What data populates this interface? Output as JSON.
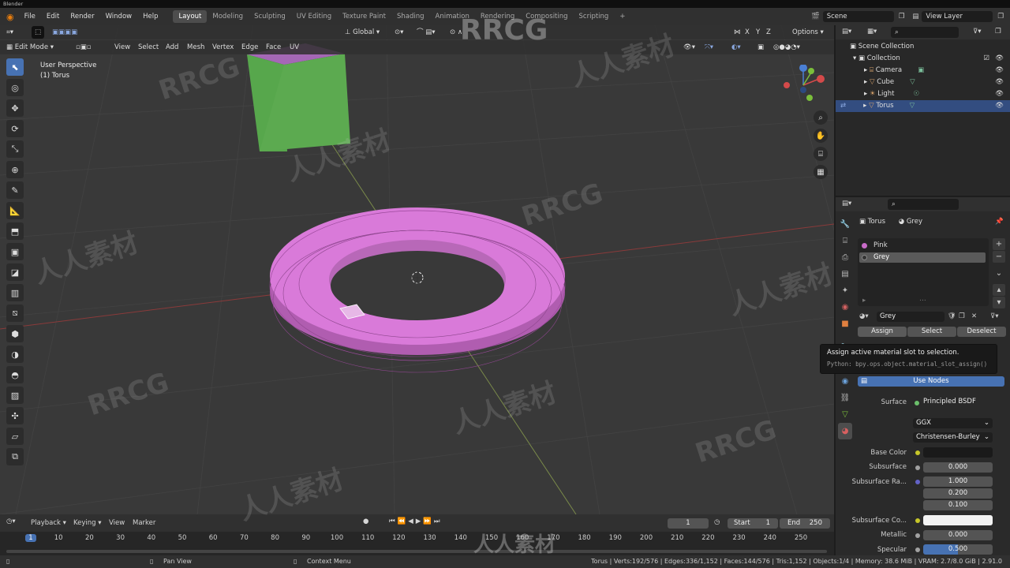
{
  "titlebar": {
    "title": "Blender"
  },
  "menu": {
    "items": [
      "File",
      "Edit",
      "Render",
      "Window",
      "Help"
    ]
  },
  "workspaces": {
    "tabs": [
      "Layout",
      "Modeling",
      "Sculpting",
      "UV Editing",
      "Texture Paint",
      "Shading",
      "Animation",
      "Rendering",
      "Compositing",
      "Scripting"
    ],
    "active": "Layout",
    "add": "+"
  },
  "scene": {
    "name": "Scene",
    "view_layer": "View Layer"
  },
  "vp_header": {
    "mode": "Edit Mode",
    "menus": [
      "View",
      "Select",
      "Add",
      "Mesh",
      "Vertex",
      "Edge",
      "Face",
      "UV"
    ],
    "orientation": "Global",
    "options": "Options",
    "axes": [
      "X",
      "Y",
      "Z"
    ]
  },
  "viewport": {
    "perspective": "User Perspective",
    "object": "(1) Torus"
  },
  "gizmo": {
    "z": "Z",
    "y": "Y",
    "x": "X"
  },
  "outliner": {
    "root": "Scene Collection",
    "collection": "Collection",
    "items": [
      {
        "name": "Camera"
      },
      {
        "name": "Cube"
      },
      {
        "name": "Light"
      },
      {
        "name": "Torus"
      }
    ]
  },
  "properties": {
    "object": "Torus",
    "material": "Grey",
    "slots": [
      {
        "name": "Pink",
        "color": "#c86bc8"
      },
      {
        "name": "Grey",
        "color": "#333333"
      }
    ],
    "slot_name": "Grey",
    "assign": "Assign",
    "select": "Select",
    "deselect": "Deselect",
    "use_nodes": "Use Nodes",
    "surface_label": "Surface",
    "surface_value": "Principled BSDF",
    "distribution": "GGX",
    "subsurface_method": "Christensen-Burley",
    "base_color_label": "Base Color",
    "subsurface_label": "Subsurface",
    "subsurface_value": "0.000",
    "subsurface_radius_label": "Subsurface Ra...",
    "subsurface_radius": [
      "1.000",
      "0.200",
      "0.100"
    ],
    "subsurface_color_label": "Subsurface Co...",
    "metallic_label": "Metallic",
    "metallic_value": "0.000",
    "specular_label": "Specular",
    "specular_value": "0.500"
  },
  "tooltip": {
    "title": "Assign active material slot to selection.",
    "python": "Python: bpy.ops.object.material_slot_assign()"
  },
  "timeline": {
    "menus": [
      "Playback",
      "Keying",
      "View",
      "Marker"
    ],
    "current": "1",
    "start_label": "Start",
    "start": "1",
    "end_label": "End",
    "end": "250",
    "ticks": [
      "1",
      "10",
      "20",
      "30",
      "40",
      "50",
      "60",
      "70",
      "80",
      "90",
      "100",
      "110",
      "120",
      "130",
      "140",
      "150",
      "160",
      "170",
      "180",
      "190",
      "200",
      "210",
      "220",
      "230",
      "240",
      "250"
    ]
  },
  "status": {
    "pan": "Pan View",
    "context": "Context Menu",
    "stats": "Torus | Verts:192/576 | Edges:336/1,152 | Faces:144/576 | Tris:1,152 | Objects:1/4 | Memory: 38.6 MiB | VRAM: 2.7/8.0 GiB | 2.91.0"
  },
  "watermarks": {
    "brand": "RRCG",
    "cn": "人人素材"
  },
  "colors": {
    "accent": "#4772b3",
    "selected_row": "#334d80",
    "torus": "#d97ad9",
    "cube": "#5caa50"
  }
}
